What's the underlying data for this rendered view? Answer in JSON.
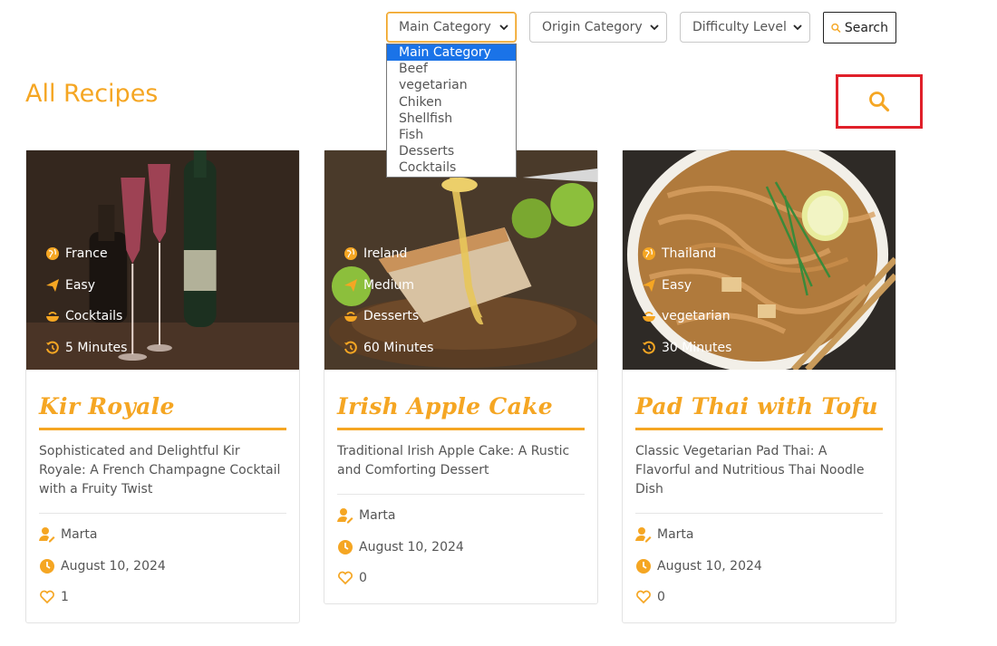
{
  "filters": {
    "main_category": {
      "label": "Main Category"
    },
    "origin_category": {
      "label": "Origin Category"
    },
    "difficulty_level": {
      "label": "Difficulty Level"
    },
    "search_label": "Search"
  },
  "dropdown": {
    "options": [
      "Main Category",
      "Beef",
      "vegetarian",
      "Chiken",
      "Shellfish",
      "Fish",
      "Desserts",
      "Cocktails"
    ],
    "selected": "Main Category"
  },
  "page": {
    "title": "All Recipes"
  },
  "colors": {
    "accent": "#f5a623",
    "highlight_border": "#e0202a",
    "dropdown_selected": "#1a73e8"
  },
  "recipes": [
    {
      "origin": "France",
      "difficulty": "Easy",
      "category": "Cocktails",
      "time": "5 Minutes",
      "title": "Kir Royale",
      "description": "Sophisticated and Delightful Kir Royale: A French Champagne Cocktail with a Fruity Twist",
      "author": "Marta",
      "date": "August 10, 2024",
      "likes": "1"
    },
    {
      "origin": "Ireland",
      "difficulty": "Medium",
      "category": "Desserts",
      "time": "60 Minutes",
      "title": "Irish Apple Cake",
      "description": "Traditional Irish Apple Cake: A Rustic and Comforting Dessert",
      "author": "Marta",
      "date": "August 10, 2024",
      "likes": "0"
    },
    {
      "origin": "Thailand",
      "difficulty": "Easy",
      "category": "vegetarian",
      "time": "30 Minutes",
      "title": "Pad Thai with Tofu",
      "description": "Classic Vegetarian Pad Thai: A Flavorful and Nutritious Thai Noodle Dish",
      "author": "Marta",
      "date": "August 10, 2024",
      "likes": "0"
    }
  ]
}
